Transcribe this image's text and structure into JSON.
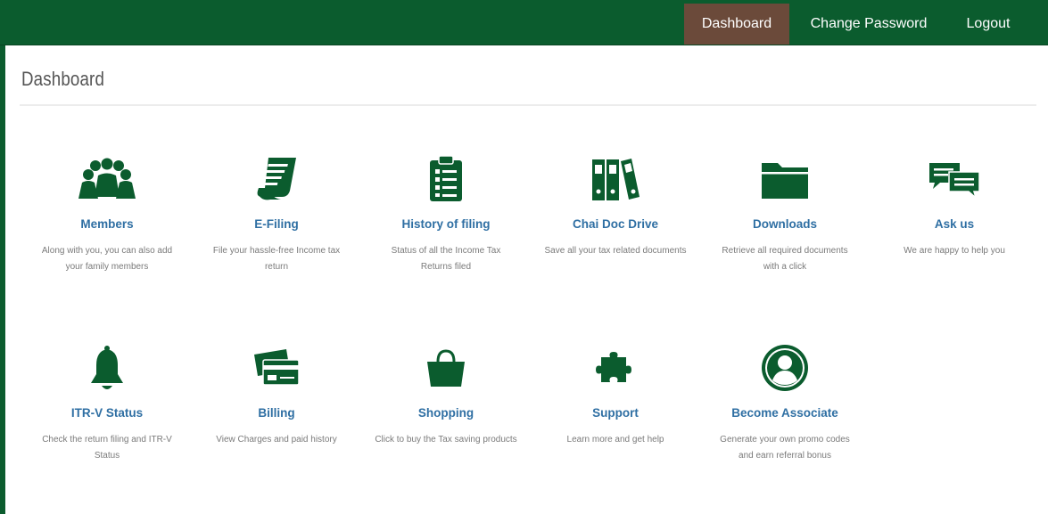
{
  "nav": {
    "dashboard": "Dashboard",
    "change_password": "Change Password",
    "logout": "Logout"
  },
  "page": {
    "title": "Dashboard"
  },
  "colors": {
    "brand": "#0b5c2e",
    "active_tab": "#6b4a3a",
    "link": "#2f6fa3",
    "muted": "#7a7a7a"
  },
  "cards": [
    {
      "icon": "members-icon",
      "label": "Members",
      "desc": "Along with you, you can also add your family members"
    },
    {
      "icon": "e-filing-icon",
      "label": "E-Filing",
      "desc": "File your hassle-free Income tax return"
    },
    {
      "icon": "clipboard-icon",
      "label": "History of filing",
      "desc": "Status of all the Income Tax Returns filed"
    },
    {
      "icon": "binders-icon",
      "label": "Chai Doc Drive",
      "desc": "Save all your tax related documents"
    },
    {
      "icon": "folder-icon",
      "label": "Downloads",
      "desc": "Retrieve all required documents with a click"
    },
    {
      "icon": "chat-icon",
      "label": "Ask us",
      "desc": "We are happy to help you"
    },
    {
      "icon": "bell-icon",
      "label": "ITR-V Status",
      "desc": "Check the return filing and ITR-V Status"
    },
    {
      "icon": "credit-card-icon",
      "label": "Billing",
      "desc": "View Charges and paid history"
    },
    {
      "icon": "shopping-bag-icon",
      "label": "Shopping",
      "desc": "Click to buy the Tax saving products"
    },
    {
      "icon": "puzzle-icon",
      "label": "Support",
      "desc": "Learn more and get help"
    },
    {
      "icon": "user-circle-icon",
      "label": "Become Associate",
      "desc": "Generate your own promo codes and earn referral bonus"
    }
  ]
}
